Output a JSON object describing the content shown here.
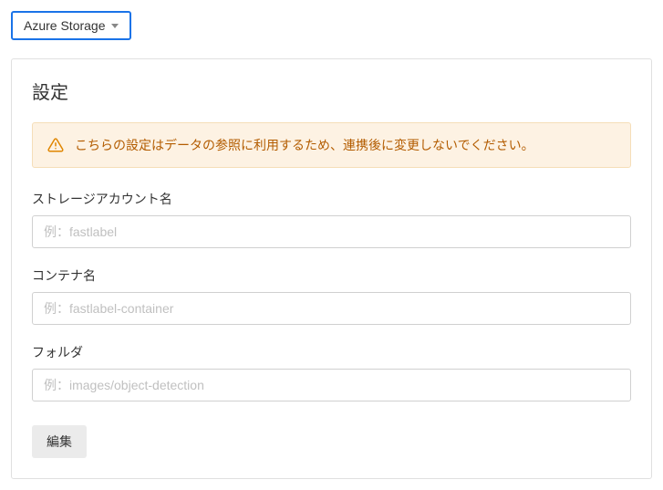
{
  "dropdown": {
    "label": "Azure Storage"
  },
  "card": {
    "title": "設定"
  },
  "alert": {
    "text": "こちらの設定はデータの参照に利用するため、連携後に変更しないでください。"
  },
  "fields": {
    "storage_account": {
      "label": "ストレージアカウント名",
      "placeholder": "例：fastlabel",
      "value": ""
    },
    "container": {
      "label": "コンテナ名",
      "placeholder": "例：fastlabel-container",
      "value": ""
    },
    "folder": {
      "label": "フォルダ",
      "placeholder": "例：images/object-detection",
      "value": ""
    }
  },
  "buttons": {
    "edit": "編集"
  }
}
